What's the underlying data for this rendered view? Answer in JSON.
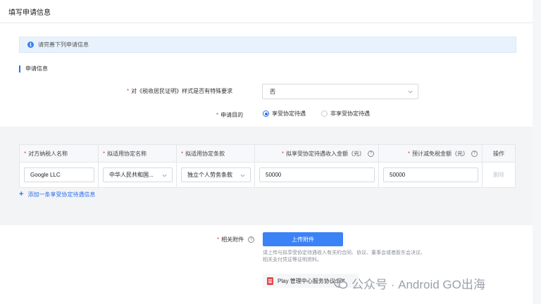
{
  "header": {
    "title": "填写申请信息"
  },
  "info": {
    "text": "请完善下列申请信息"
  },
  "section": {
    "title": "申请信息"
  },
  "form": {
    "special_req_label": "对《税收居民证明》样式是否有特殊要求",
    "special_req_value": "否",
    "purpose_label": "申请目的",
    "purpose_options": [
      "享受协定待遇",
      "非享受协定待遇"
    ],
    "purpose_selected": "享受协定待遇"
  },
  "table": {
    "headers": [
      "对方纳税人名称",
      "拟适用协定名称",
      "拟适用协定条款",
      "拟享受协定待遇收入金额（元）",
      "预计减免税金额（元）",
      "操作"
    ],
    "row": {
      "name": "Google LLC",
      "treaty": "中华人民共和国...",
      "clause": "独立个人劳务条款",
      "income": "50000",
      "reduction": "50000",
      "action": "删除"
    }
  },
  "add_link": {
    "label": "添加一条享受协定待遇信息"
  },
  "attachment": {
    "label": "相关附件",
    "upload_label": "上传附件",
    "hint": "请上传与拟享受协定待遇收入有关的合同、协议、董事会或者股东会决议、相关支付凭证等证明资料。",
    "file_name": "Play 管理中心服务协议.pdf"
  },
  "watermark": {
    "text": "公众号 · Android GO出海"
  },
  "colors": {
    "accent": "#2d6fef",
    "required": "#e54545",
    "upload_button": "#3b82f6"
  }
}
